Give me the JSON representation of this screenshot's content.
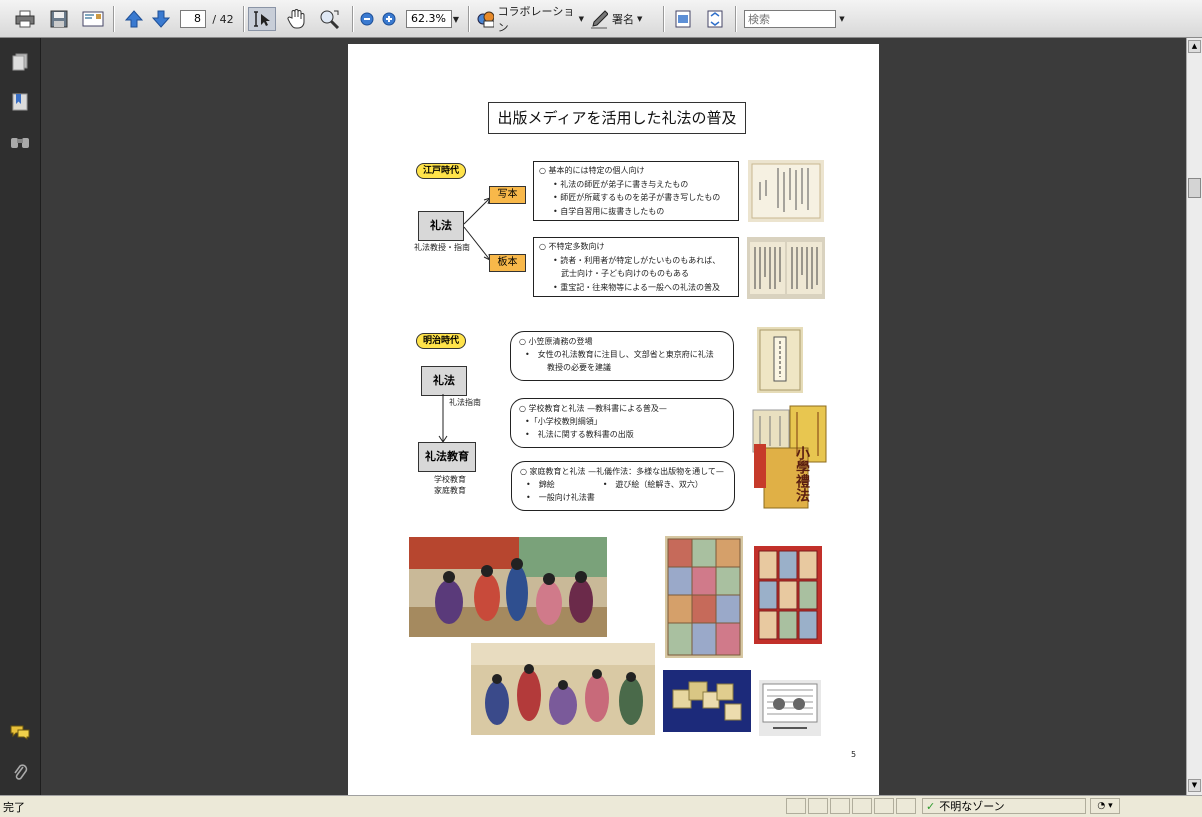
{
  "toolbar": {
    "page_current": "8",
    "page_total": "/ 42",
    "zoom": "62.3%",
    "collab_label": "コラボレーション",
    "sign_label": "署名",
    "search_placeholder": "検索"
  },
  "icons": {
    "print": "printer-icon",
    "save": "save-icon",
    "email": "email-icon",
    "prev": "arrow-up-icon",
    "next": "arrow-down-icon",
    "select": "select-cursor-icon",
    "hand": "hand-icon",
    "zoom_tool": "zoom-tool-icon",
    "zoom_out": "zoom-out-icon",
    "zoom_in": "zoom-in-icon"
  },
  "document": {
    "title": "出版メディアを活用した礼法の普及",
    "edo": {
      "era": "江戸時代",
      "center": "礼法",
      "center_caption": "礼法教授・指南",
      "copy": "写本",
      "woodblock": "板本",
      "box1_head": "○ 基本的には特定の個人向け",
      "box1_items": [
        "礼法の師匠が弟子に書き与えたもの",
        "師匠が所蔵するものを弟子が書き写したもの",
        "自学自習用に抜書きしたもの"
      ],
      "box2_head": "○ 不特定多数向け",
      "box2_items": [
        "読者・利用者が特定しがたいものもあれば、",
        "武士向け・子ども向けのものもある",
        "重宝記・往来物等による一般への礼法の普及"
      ]
    },
    "meiji": {
      "era": "明治時代",
      "top": "礼法",
      "arrow_caption": "礼法指南",
      "bottom": "礼法教育",
      "bottom_cap1": "学校教育",
      "bottom_cap2": "家庭教育",
      "b1_head": "○ 小笠原清務の登場",
      "b1_l1": "•　女性の礼法教育に注目し、文部省と東京府に礼法",
      "b1_l2": "教授の必要を建議",
      "b2_head": "○ 学校教育と礼法 —教科書による普及—",
      "b2_l1": "•「小学校教則綱領」",
      "b2_l2": "•　礼法に関する教科書の出版",
      "b3_head": "○ 家庭教育と礼法 —礼儀作法：多様な出版物を通して—",
      "b3_l1a": "•　錦絵",
      "b3_l1b": "•　遊び絵（絵解き、双六）",
      "b3_l2": "•　一般向け礼法書",
      "book_title": "小學禮法"
    },
    "page_number": "5"
  },
  "status": {
    "left": "完了",
    "zone": "不明なゾーン"
  }
}
